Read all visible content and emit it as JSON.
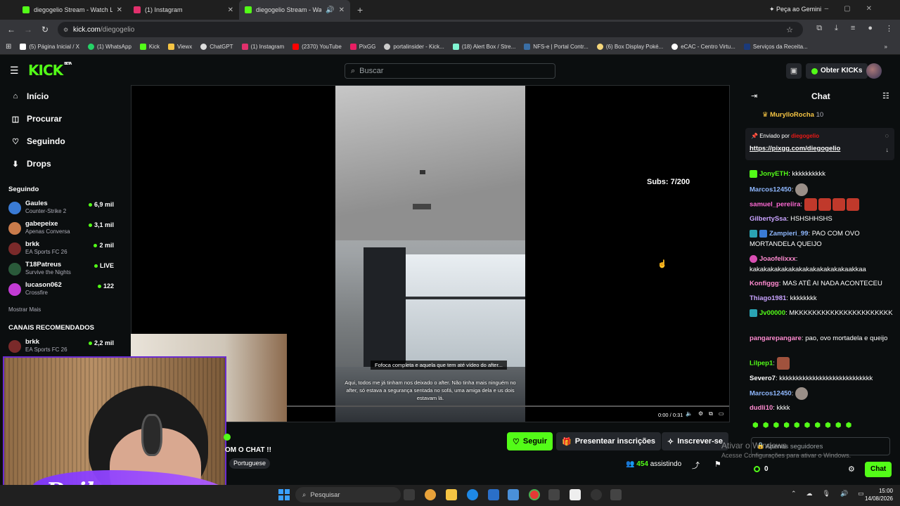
{
  "browser": {
    "tabs": [
      {
        "title": "diegogelio Stream - Watch Live",
        "color": "#53fc18",
        "active": false
      },
      {
        "title": "(1) Instagram",
        "color": "#e1306c",
        "active": false
      },
      {
        "title": "diegogelio Stream - Watch",
        "color": "#53fc18",
        "active": true
      }
    ],
    "new_tab": "+",
    "gemini": "Peça ao Gemini",
    "url_host": "kick.com",
    "url_path": "/diegogelio",
    "bookmarks": [
      "(5) Página Inicial / X",
      "(1) WhatsApp",
      "Kick",
      "Viewx",
      "ChatGPT",
      "(1) Instagram",
      "(2370) YouTube",
      "PixGG",
      "portalinsider - Kick...",
      "(18) Alert Box / Stre...",
      "NFS-e | Portal Contr...",
      "(6) Box Display Poké...",
      "eCAC - Centro Virtu...",
      "Serviços da Receita..."
    ]
  },
  "header": {
    "logo": "KICK",
    "logo_badge": "BETA",
    "search_placeholder": "Buscar",
    "kicks_button": "Obter KICKs"
  },
  "sidebar": {
    "nav": [
      {
        "label": "Início",
        "icon": "home-icon"
      },
      {
        "label": "Procurar",
        "icon": "browse-icon"
      },
      {
        "label": "Seguindo",
        "icon": "heart-icon"
      },
      {
        "label": "Drops",
        "icon": "drops-icon"
      }
    ],
    "following_heading": "Seguindo",
    "following": [
      {
        "name": "Gaules",
        "game": "Counter-Strike 2",
        "viewers": "6,9 mil",
        "color": "#3a7bd5"
      },
      {
        "name": "gabepeixe",
        "game": "Apenas Conversa",
        "viewers": "3,1 mil",
        "color": "#c97b4a"
      },
      {
        "name": "brkk",
        "game": "EA Sports FC 26",
        "viewers": "2 mil",
        "color": "#7a2a2a"
      },
      {
        "name": "T18Patreus",
        "game": "Survive the Nights",
        "viewers": "LIVE",
        "color": "#2a5a3a"
      },
      {
        "name": "lucason062",
        "game": "Crossfire",
        "viewers": "122",
        "color": "#c23bd4"
      }
    ],
    "show_more": "Mostrar Mais",
    "recommended_heading": "CANAIS RECOMENDADOS",
    "recommended": [
      {
        "name": "brkk",
        "game": "EA Sports FC 26",
        "viewers": "2,2 mil",
        "color": "#7a2a2a"
      }
    ]
  },
  "player": {
    "subs_goal": "Subs: 7/200",
    "caption_top": "Fofoca completa e aquela que tem até vídeo do after...",
    "caption_bottom": "Aqui, todos me já tinham nos deixado o after. Não tinha mais ninguém no after, só estava a segurança sentada no sofá, uma amiga dela e us dois estavam lá.",
    "time": "0:00 / 0:31",
    "progress": 0.0
  },
  "stream": {
    "title": "OM O CHAT !!",
    "language": "Portuguese",
    "webcam_logo_text": "Deil",
    "follow_label": "Seguir",
    "gift_label": "Presentear inscrições",
    "subscribe_label": "Inscrever-se",
    "viewer_count": "454",
    "viewer_suffix": "assistindo"
  },
  "chat": {
    "title": "Chat",
    "gifter": {
      "name": "MurylloRocha",
      "count": "10"
    },
    "pinned_by_prefix": "Enviado por",
    "pinned_by": "diegogelio",
    "pinned_link": "https://pixgg.com/diegogelio",
    "messages": [
      {
        "user": "JonyETH",
        "color": "#53fc18",
        "text": "kkkkkkkkkk",
        "badge": "#53fc18"
      },
      {
        "user": "Marcos12450",
        "color": "#8fb8ff",
        "text": "",
        "emotes": 1
      },
      {
        "user": "samuel_pereiira",
        "color": "#ff6ad5",
        "text": "",
        "emotes": 4
      },
      {
        "user": "GilbertySsa",
        "color": "#c9a3ff",
        "text": "HSHSHHSHS"
      },
      {
        "user": "Zampieri_99",
        "color": "#8fb8ff",
        "text": "PAO COM OVO MORTANDELA QUEIJO",
        "badge": "#2aa3b3"
      },
      {
        "user": "Joaofelixxx",
        "color": "#ff8bd0",
        "text": "kakakakakakakakakakakakakakaakkaa",
        "badge": "#d94fb3"
      },
      {
        "user": "Konfiggg",
        "color": "#ff8bd0",
        "text": "MAS ATÉ AI NADA ACONTECEU"
      },
      {
        "user": "Thiago1981",
        "color": "#c9a3ff",
        "text": "kkkkkkkk"
      },
      {
        "user": "Jv00000",
        "color": "#53fc18",
        "text": "MKKKKKKKKKKKKKKKKKKKKKK",
        "badge": "#2aa3b3"
      },
      {
        "user": "pangarepangare",
        "color": "#ff8bd0",
        "text": "pao, ovo mortadela e queijo"
      },
      {
        "user": "Lilpep1",
        "color": "#53fc18",
        "text": "",
        "emotes": 1
      },
      {
        "user": "Severo7",
        "color": "#ffffff",
        "text": "kkkkkkkkkkkkkkkkkkkkkkkkkkkk"
      },
      {
        "user": "Marcos12450",
        "color": "#8fb8ff",
        "text": "",
        "emotes": 1
      },
      {
        "user": "dudli10",
        "color": "#ff8bd0",
        "text": "kkkk"
      }
    ],
    "input_placeholder": "Apenas seguidores",
    "points": "0",
    "send_label": "Chat"
  },
  "windows": {
    "activate_title": "Ativar o Windows",
    "activate_sub": "Acesse Configurações para ativar o Windows.",
    "search_placeholder": "Pesquisar",
    "time": "15:00",
    "date": "14/08/2026"
  }
}
